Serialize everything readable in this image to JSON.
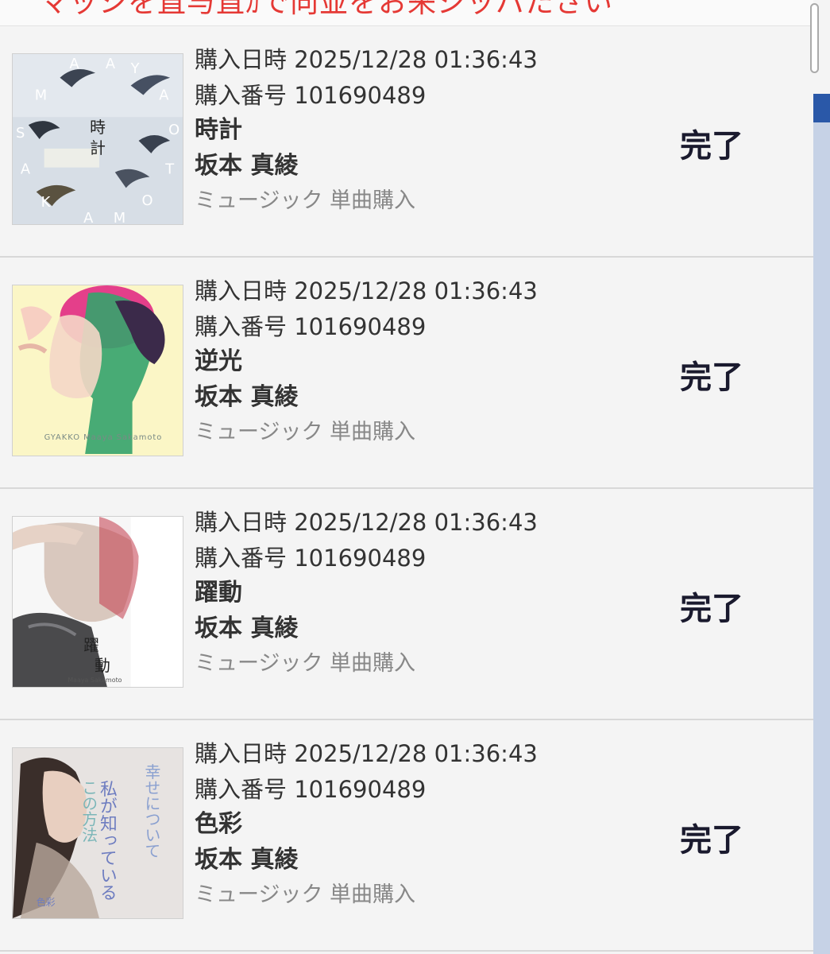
{
  "notice": "マッシを直与直ｶで向並をお来ジッパたさい",
  "purchases": [
    {
      "date_label": "購入日時",
      "date_value": "2025/12/28 01:36:43",
      "number_label": "購入番号",
      "number_value": "101690489",
      "title": "時計",
      "artist": "坂本 真綾",
      "category": "ミュージック 単曲購入",
      "status": "完了",
      "cover": {
        "type": "birds",
        "text": "時計",
        "letters": [
          "M",
          "A",
          "A",
          "Y",
          "A",
          "S",
          "O",
          "A",
          "T",
          "K",
          "M",
          "O",
          "A"
        ]
      }
    },
    {
      "date_label": "購入日時",
      "date_value": "2025/12/28 01:36:43",
      "number_label": "購入番号",
      "number_value": "101690489",
      "title": "逆光",
      "artist": "坂本 真綾",
      "category": "ミュージック 単曲購入",
      "status": "完了",
      "cover": {
        "type": "gyakko",
        "text": "GYAKKO Maaya Sakamoto"
      }
    },
    {
      "date_label": "購入日時",
      "date_value": "2025/12/28 01:36:43",
      "number_label": "購入番号",
      "number_value": "101690489",
      "title": "躍動",
      "artist": "坂本 真綾",
      "category": "ミュージック 単曲購入",
      "status": "完了",
      "cover": {
        "type": "yakudo",
        "text": "躍動",
        "sub": "Maaya Sakamoto"
      }
    },
    {
      "date_label": "購入日時",
      "date_value": "2025/12/28 01:36:43",
      "number_label": "購入番号",
      "number_value": "101690489",
      "title": "色彩",
      "artist": "坂本 真綾",
      "category": "ミュージック 単曲購入",
      "status": "完了",
      "cover": {
        "type": "shikisai",
        "text": "私が知っている",
        "text2": "幸せについて",
        "text3": "この方法",
        "text4": "色彩"
      }
    }
  ],
  "colors": {
    "notice": "#e53935",
    "status": "#1a1a2e",
    "scroll_thumb": "#2a58a8",
    "scroll_track": "#c6d2e6"
  }
}
